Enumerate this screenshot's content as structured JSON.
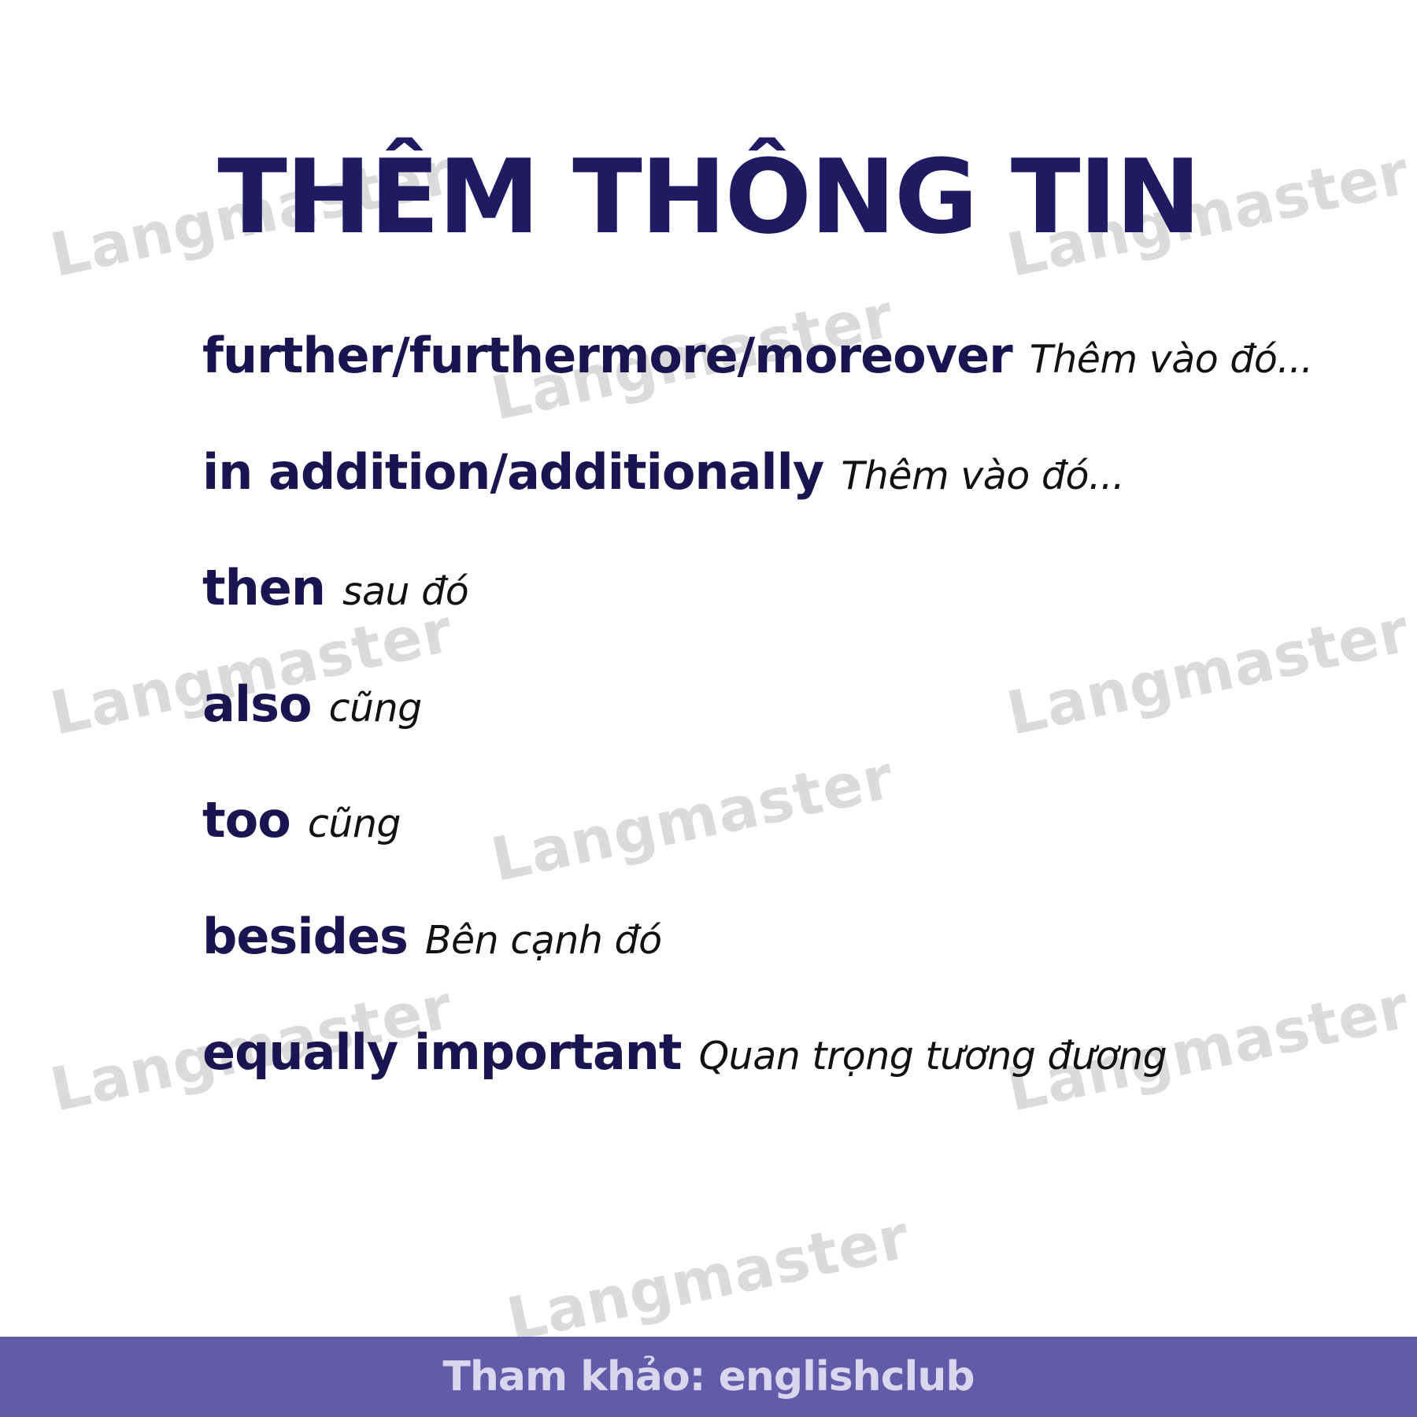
{
  "title": "THÊM THÔNG TIN",
  "phrases": [
    {
      "term": "further/furthermore/moreover",
      "meaning": "Thêm vào đó..."
    },
    {
      "term": "in addition/additionally",
      "meaning": "Thêm vào đó..."
    },
    {
      "term": "then",
      "meaning": "sau đó"
    },
    {
      "term": "also",
      "meaning": "cũng"
    },
    {
      "term": "too",
      "meaning": "cũng"
    },
    {
      "term": "besides",
      "meaning": "Bên cạnh đó"
    },
    {
      "term": "equally important",
      "meaning": "Quan trọng tương đương"
    }
  ],
  "watermark": "Langmaster",
  "footer": "Tham khảo: englishclub",
  "colors": {
    "title": "#1f1a62",
    "term": "#1a1450",
    "footer_background": "#615ba9",
    "footer_text": "#d9d6ee"
  }
}
